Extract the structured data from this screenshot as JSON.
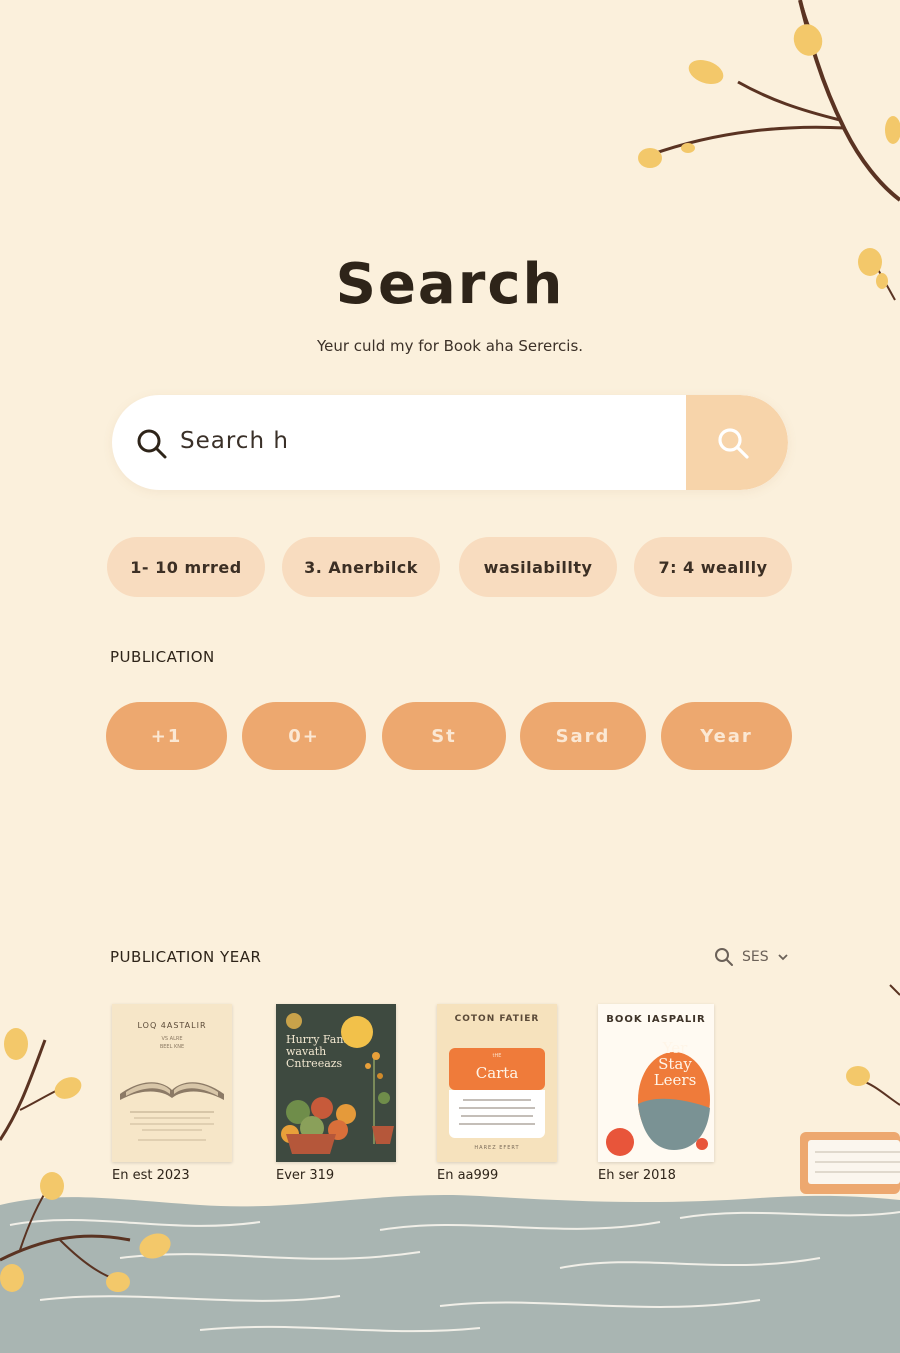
{
  "header": {
    "title": "Search",
    "subtitle": "Yeur culd my for Book aha Serercis."
  },
  "search": {
    "value": "Search h",
    "submit_icon": "search-icon"
  },
  "filter_chips": [
    "1- 10 mrred",
    "3. Anerbilck",
    "wasilabillty",
    "7: 4 weallly"
  ],
  "publication": {
    "label": "PUBLICATION",
    "pills": [
      "+1",
      "0+",
      "St",
      "Sard",
      "Year"
    ]
  },
  "results": {
    "label": "PUBLICATION YEAR",
    "sort_label": "SES",
    "books": [
      {
        "cover_title": "LOQ 4ASTALIR",
        "cover_sub": [
          "VS ALRE",
          "BEEL KNE"
        ],
        "caption": "En est 2023"
      },
      {
        "cover_title": "Hurry Fanat wavath Cntreeazs",
        "caption": "Ever 319"
      },
      {
        "cover_title": "COTON FATIER",
        "cover_badge_top": "tHE",
        "cover_badge": "Carta",
        "cover_footer": "HAREZ EFERT",
        "caption": "En aa999"
      },
      {
        "cover_title": "BOOK IASPALIR",
        "cover_badge": "Yer Stay Leers",
        "caption": "Eh ser 2018"
      }
    ]
  },
  "colors": {
    "background": "#fbf0dc",
    "chip": "#f8dcbf",
    "pill": "#eda86f",
    "accent_button": "#f7d4aa",
    "leaf": "#f3c86a",
    "branch": "#5a3322",
    "water": "#a9b5b2"
  }
}
